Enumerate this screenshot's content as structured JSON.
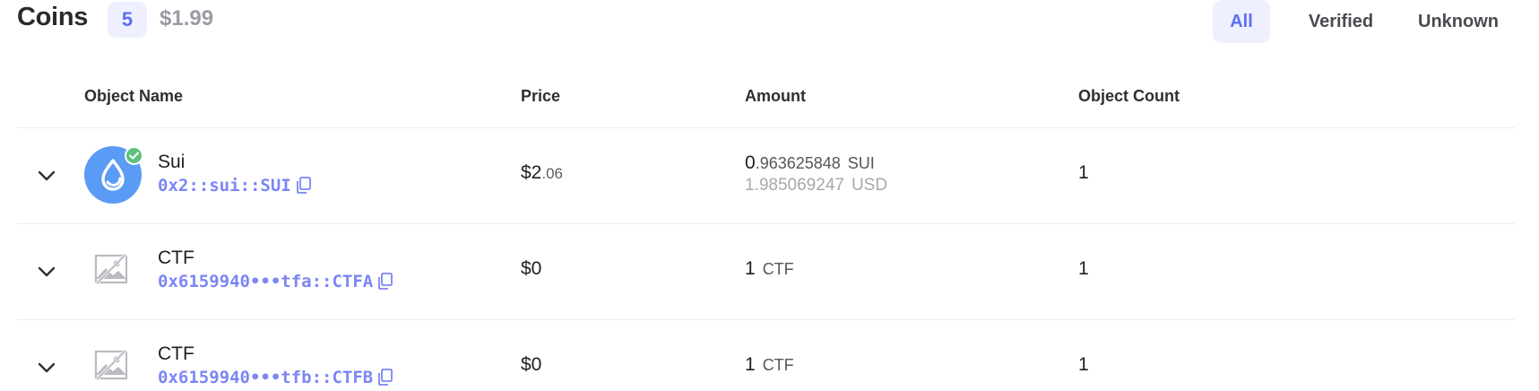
{
  "header": {
    "title": "Coins",
    "count": "5",
    "total_value": "$1.99",
    "filters": [
      {
        "label": "All",
        "active": true
      },
      {
        "label": "Verified",
        "active": false
      },
      {
        "label": "Unknown",
        "active": false
      }
    ]
  },
  "table": {
    "columns": [
      "Object Name",
      "Price",
      "Amount",
      "Object Count"
    ],
    "rows": [
      {
        "name": "Sui",
        "type": "0x2::sui::SUI",
        "icon": "sui-logo-icon",
        "verified": true,
        "price_int": "$2",
        "price_dec": ".06",
        "amount_int": "0",
        "amount_dec": ".963625848",
        "amount_unit": "SUI",
        "usd_value": "1.985069247",
        "usd_unit": "USD",
        "object_count": "1"
      },
      {
        "name": "CTF",
        "type": "0x6159940•••tfa::CTFA",
        "icon": "image-placeholder-icon",
        "verified": false,
        "price_int": "$0",
        "price_dec": "",
        "amount_int": "1",
        "amount_dec": "",
        "amount_unit": "CTF",
        "object_count": "1"
      },
      {
        "name": "CTF",
        "type": "0x6159940•••tfb::CTFB",
        "icon": "image-placeholder-icon",
        "verified": false,
        "price_int": "$0",
        "price_dec": "",
        "amount_int": "1",
        "amount_dec": "",
        "amount_unit": "CTF",
        "object_count": "1"
      }
    ]
  },
  "colors": {
    "accent": "#5b6ff5",
    "accent_bg": "#eef0ff",
    "type_text": "#7b86f5",
    "sui_blue": "#5a9bf5",
    "verified_green": "#5cc27a"
  }
}
